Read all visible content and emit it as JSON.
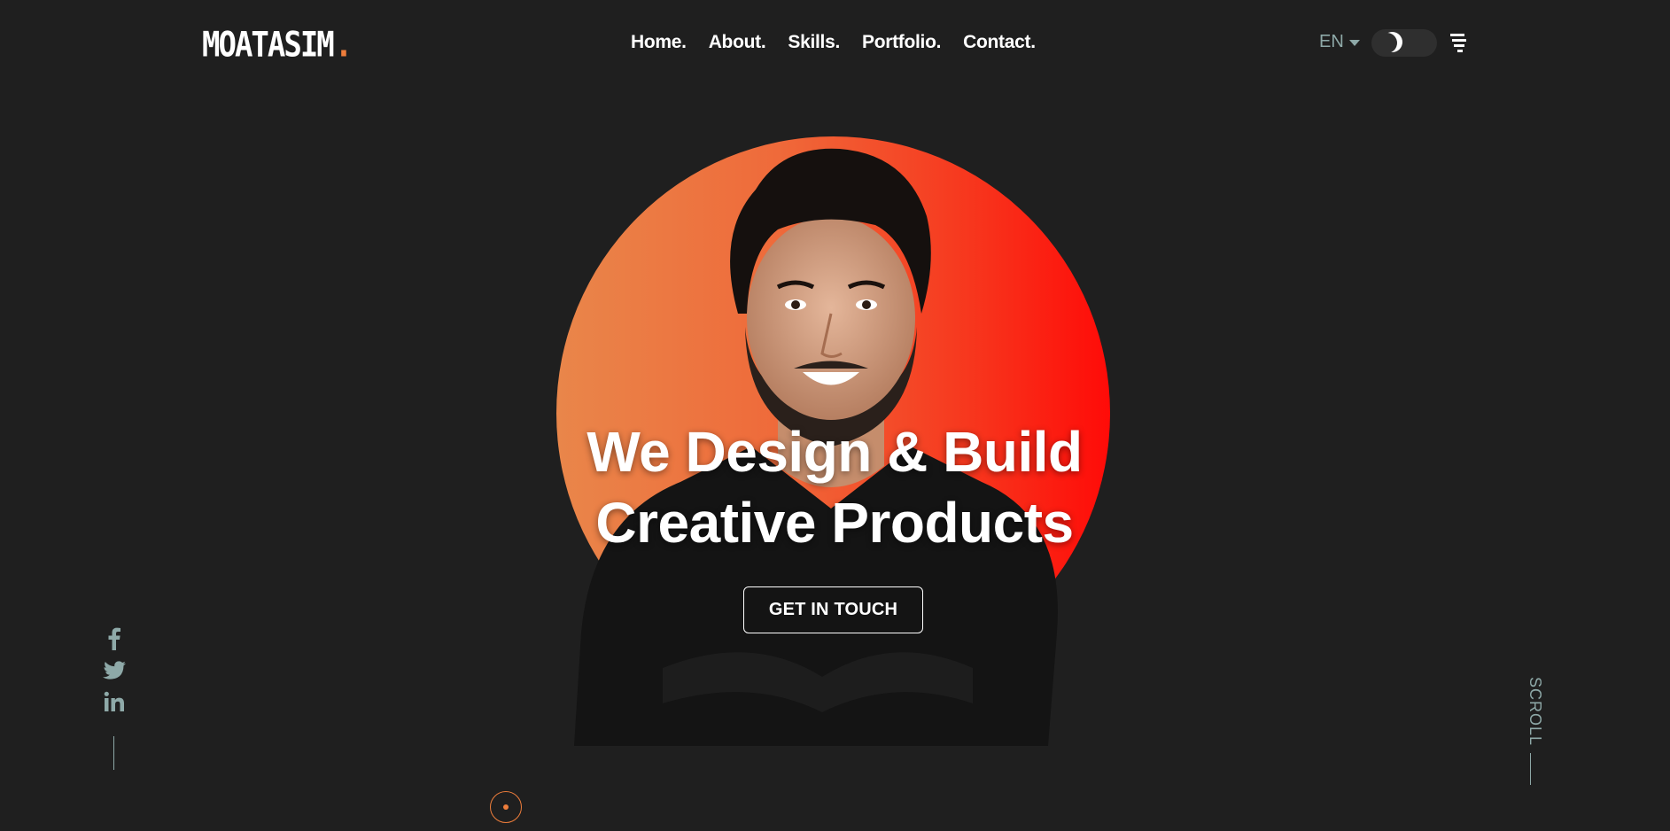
{
  "header": {
    "logo": {
      "text": "MOATASIM",
      "dot": "."
    },
    "nav": [
      {
        "label": "Home."
      },
      {
        "label": "About."
      },
      {
        "label": "Skills."
      },
      {
        "label": "Portfolio."
      },
      {
        "label": "Contact."
      }
    ],
    "language": "EN",
    "theme_toggle_icon": "moon-icon",
    "menu_icon": "stacked-lines-menu-icon"
  },
  "hero": {
    "title_line1": "We Design & Build",
    "title_line2": "Creative Products",
    "cta_label": "GET IN TOUCH",
    "circle_gradient": [
      "#e9864a",
      "#ff0b08"
    ]
  },
  "social": [
    {
      "icon": "facebook-icon"
    },
    {
      "icon": "twitter-icon"
    },
    {
      "icon": "linkedin-icon"
    }
  ],
  "scroll_label": "SCROLL",
  "colors": {
    "background": "#1f1f1f",
    "accent": "#ee7d3b",
    "muted": "#8ea9a8",
    "text": "#ffffff"
  }
}
